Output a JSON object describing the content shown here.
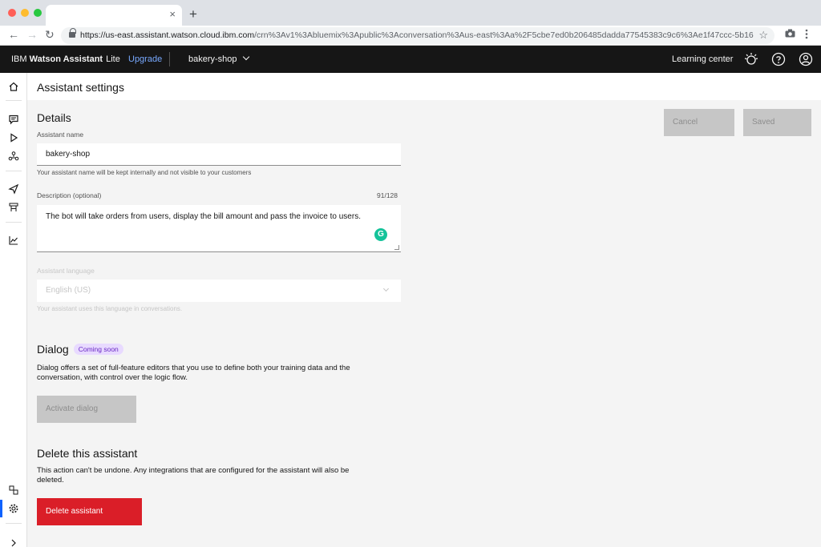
{
  "browser": {
    "url_host": "https://us-east.assistant.watson.cloud.ibm.com",
    "url_path": "/crn%3Av1%3Abluemix%3Apublic%3Aconversation%3Aus-east%3Aa%2F5cbe7ed0b206485dadda77545383c9c6%3Ae1f47ccc-5b16-4...",
    "tab_close": "×",
    "new_tab": "+"
  },
  "header": {
    "brand_prefix": "IBM",
    "brand_name": "Watson Assistant",
    "plan": "Lite",
    "upgrade": "Upgrade",
    "assistant": "bakery-shop",
    "learning_center": "Learning center"
  },
  "page": {
    "title": "Assistant settings"
  },
  "details": {
    "heading": "Details",
    "name_label": "Assistant name",
    "name_value": "bakery-shop",
    "name_helper": "Your assistant name will be kept internally and not visible to your customers",
    "desc_label": "Description (optional)",
    "desc_counter": "91/128",
    "desc_value": "The bot will take orders from users, display the bill amount and pass the invoice to users.",
    "lang_label": "Assistant language",
    "lang_value": "English (US)",
    "lang_helper": "Your assistant uses this language in conversations.",
    "cancel": "Cancel",
    "saved": "Saved"
  },
  "dialog": {
    "heading": "Dialog",
    "tag": "Coming soon",
    "text_line1": "Dialog offers a set of full-feature editors that you use to define both your training data and the",
    "text_line2": "conversation, with control over the logic flow.",
    "button": "Activate dialog"
  },
  "delete": {
    "heading": "Delete this assistant",
    "text_line1": "This action can't be undone. Any integrations that are configured for the assistant will also be",
    "text_line2": "deleted.",
    "button": "Delete assistant"
  },
  "colors": {
    "accent": "#0f62fe",
    "danger": "#da1e28",
    "header_bg": "#161616"
  }
}
